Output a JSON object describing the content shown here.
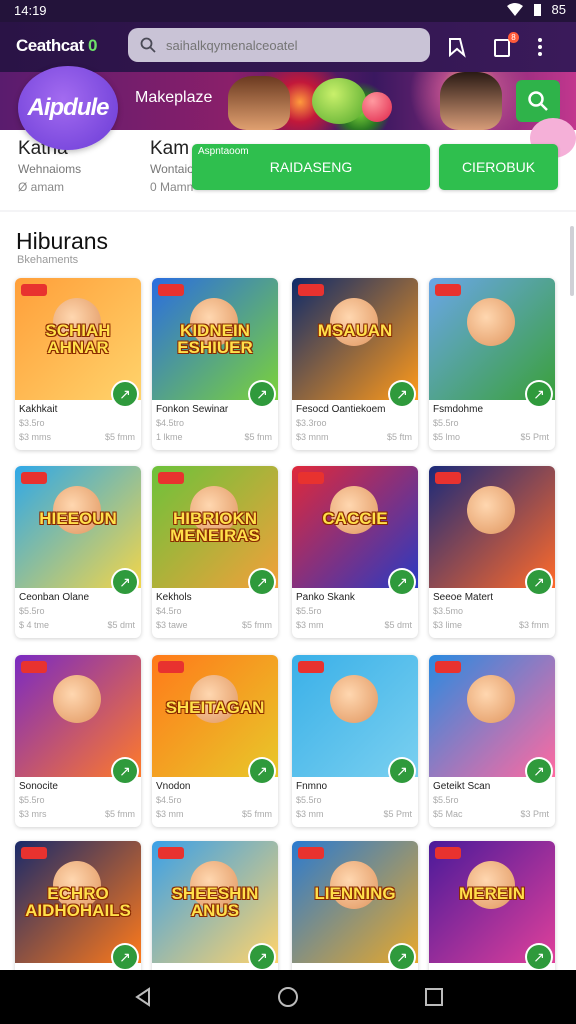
{
  "status_bar": {
    "time": "14:19",
    "battery": "85"
  },
  "app_bar": {
    "logo": "Ceathcat",
    "logo_suffix": "0",
    "search_placeholder": "saihalkqymenalceoatel",
    "notification_count": "8"
  },
  "banner": {
    "badge_text": "Aipdule",
    "title": "Makeplaze"
  },
  "stats": [
    {
      "title": "Katna",
      "line1": "Wehnaioms",
      "line2": "Ø amam"
    },
    {
      "title": "Kam",
      "line1": "Wontaio",
      "line2": "0 Mamn"
    }
  ],
  "actions": {
    "label": "Aspntaoom",
    "primary": "RAIDASENG",
    "secondary": "CIEROBUK"
  },
  "section": {
    "title": "Hiburans",
    "subtitle": "Bkehaments"
  },
  "cards": [
    {
      "title": "SCHIAH AHNAR",
      "name": "Kakhkait",
      "line2": "$3.5ro",
      "line3": "$3 mms",
      "line3r": "$5 fmm",
      "bg": "#ff9f3a",
      "bg2": "#ffd36b"
    },
    {
      "title": "KIDNEIN ESHIUER",
      "name": "Fonkon Sewinar",
      "line2": "$4.5tro",
      "line3": "1 lkme",
      "line3r": "$5 fnm",
      "bg": "#2a6de0",
      "bg2": "#7bd23a"
    },
    {
      "title": "MSAUAN",
      "name": "Fesocd Oantiekoem",
      "line2": "$3.3roo",
      "line3": "$3 mnm",
      "line3r": "$5 ftm",
      "bg": "#0e2a6a",
      "bg2": "#ff9a1a"
    },
    {
      "title": "",
      "name": "Fsmdohme",
      "line2": "$5.5ro",
      "line3": "$5 lmo",
      "line3r": "$5 Pmt",
      "bg": "#6aa6e8",
      "bg2": "#3aa03a"
    },
    {
      "title": "HIEEOUN",
      "name": "Ceonban Olane",
      "line2": "$5.5ro",
      "line3": "$ 4 tme",
      "line3r": "$5 dmt",
      "bg": "#2fa8e8",
      "bg2": "#f2d54a"
    },
    {
      "title": "HIBRIOKN MENEIRAS",
      "name": "Kekhols",
      "line2": "$4.5ro",
      "line3": "$3 tawe",
      "line3r": "$5 fmm",
      "bg": "#6cc23a",
      "bg2": "#f2a03a"
    },
    {
      "title": "CACCIE",
      "name": "Panko Skank",
      "line2": "$5.5ro",
      "line3": "$3 mm",
      "line3r": "$5 dmt",
      "bg": "#e0283a",
      "bg2": "#2a3ac2"
    },
    {
      "title": "",
      "name": "Seeoe Matert",
      "line2": "$3.5mo",
      "line3": "$3 lime",
      "line3r": "$3 fmm",
      "bg": "#1a2a7a",
      "bg2": "#ff6a2a"
    },
    {
      "title": "",
      "name": "Sonocite",
      "line2": "$5.5ro",
      "line3": "$3 mrs",
      "line3r": "$5 fmm",
      "bg": "#7a2ac2",
      "bg2": "#ff7a2a"
    },
    {
      "title": "SHEITAGAN",
      "name": "Vnodon",
      "line2": "$4.5ro",
      "line3": "$3 mm",
      "line3r": "$5 fmm",
      "bg": "#ff7a1a",
      "bg2": "#e8c82a"
    },
    {
      "title": "",
      "name": "Fnmno",
      "line2": "$5.5ro",
      "line3": "$3 mm",
      "line3r": "$5 Pmt",
      "bg": "#3ab0e8",
      "bg2": "#7ad0f0"
    },
    {
      "title": "",
      "name": "Geteikt Scan",
      "line2": "$5.5ro",
      "line3": "$5 Mac",
      "line3r": "$3 Pmt",
      "bg": "#2a8ae0",
      "bg2": "#ff6aa0"
    },
    {
      "title": "ECHRO AIDHOHAILS",
      "name": "",
      "line2": "",
      "line3": "",
      "line3r": "",
      "bg": "#1a2a6a",
      "bg2": "#ff7a1a"
    },
    {
      "title": "SHEESHIN ANUS",
      "name": "",
      "line2": "",
      "line3": "",
      "line3r": "",
      "bg": "#3aa0e8",
      "bg2": "#ffd36b"
    },
    {
      "title": "LIENNING",
      "name": "",
      "line2": "",
      "line3": "",
      "line3r": "",
      "bg": "#2a7ad0",
      "bg2": "#e8a82a"
    },
    {
      "title": "MEREIN",
      "name": "",
      "line2": "",
      "line3": "",
      "line3r": "",
      "bg": "#4a1a9a",
      "bg2": "#e0409a"
    }
  ]
}
